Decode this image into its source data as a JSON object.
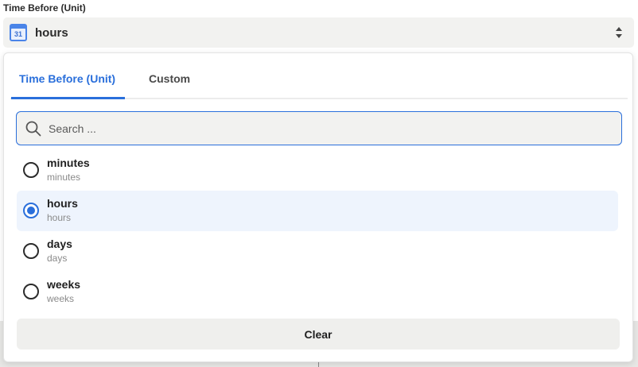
{
  "field": {
    "label": "Time Before (Unit)",
    "selected_value": "hours",
    "icon": "calendar-icon",
    "icon_text": "31"
  },
  "dropdown": {
    "tabs": [
      {
        "label": "Time Before (Unit)",
        "active": true
      },
      {
        "label": "Custom",
        "active": false
      }
    ],
    "search": {
      "placeholder": "Search ...",
      "value": ""
    },
    "options": [
      {
        "label": "minutes",
        "sublabel": "minutes",
        "selected": false
      },
      {
        "label": "hours",
        "sublabel": "hours",
        "selected": true
      },
      {
        "label": "days",
        "sublabel": "days",
        "selected": false
      },
      {
        "label": "weeks",
        "sublabel": "weeks",
        "selected": false
      }
    ],
    "clear_label": "Clear"
  },
  "colors": {
    "accent": "#2a6fdb",
    "selected_row_bg": "#eef4fd",
    "field_bg": "#f2f2f0"
  }
}
